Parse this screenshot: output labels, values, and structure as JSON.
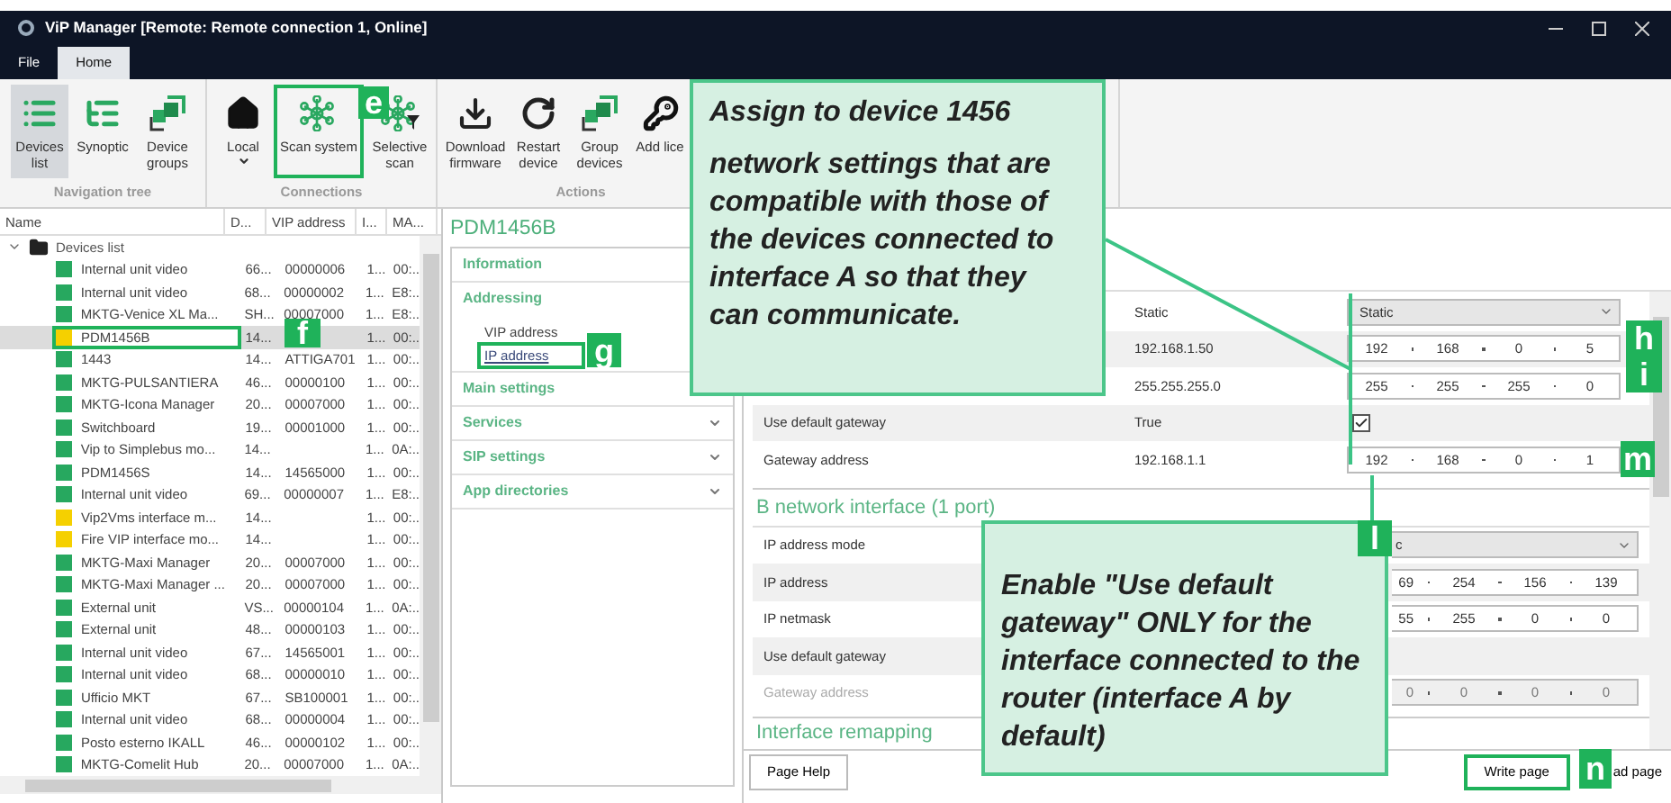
{
  "window": {
    "title": "ViP Manager [Remote: Remote connection 1, Online]"
  },
  "menu": [
    {
      "label": "File",
      "selected": false
    },
    {
      "label": "Home",
      "selected": true
    }
  ],
  "ribbon": [
    {
      "label": "Navigation tree",
      "buttons": [
        {
          "lines": [
            "Devices",
            "list"
          ],
          "selected": true,
          "dropdown": false,
          "marked": false
        },
        {
          "lines": [
            "Synoptic"
          ],
          "selected": false,
          "dropdown": false,
          "marked": false
        },
        {
          "lines": [
            "Device",
            "groups"
          ],
          "selected": false,
          "dropdown": false,
          "marked": false
        }
      ]
    },
    {
      "label": "Connections",
      "buttons": [
        {
          "lines": [
            "Local"
          ],
          "selected": false,
          "dropdown": true,
          "marked": false
        },
        {
          "lines": [
            "Scan system"
          ],
          "selected": false,
          "dropdown": false,
          "marked": true
        },
        {
          "lines": [
            "Selective",
            "scan"
          ],
          "selected": false,
          "dropdown": false,
          "marked": false
        }
      ]
    },
    {
      "label": "Actions",
      "buttons": [
        {
          "lines": [
            "Download",
            "firmware"
          ],
          "selected": false,
          "dropdown": false,
          "marked": false
        },
        {
          "lines": [
            "Restart",
            "device"
          ],
          "selected": false,
          "dropdown": false,
          "marked": false
        },
        {
          "lines": [
            "Group",
            "devices"
          ],
          "selected": false,
          "dropdown": false,
          "marked": false
        },
        {
          "lines": [
            "Add lice"
          ],
          "selected": false,
          "dropdown": false,
          "marked": false
        }
      ]
    }
  ],
  "tree": {
    "columns": [
      "Name",
      "D...",
      "VIP address",
      "I...",
      "MA..."
    ],
    "root": {
      "label": "Devices list",
      "expanded": true,
      "children": [
        {
          "name": "Internal unit video",
          "color": "#27a85f",
          "d": "66...",
          "vip": "00000006",
          "i": "1...",
          "mac": "00:..",
          "selected": false,
          "marked": false
        },
        {
          "name": "Internal unit video",
          "color": "#27a85f",
          "d": "68...",
          "vip": "00000002",
          "i": "1...",
          "mac": "E8:..",
          "selected": false,
          "marked": false
        },
        {
          "name": "MKTG-Venice XL Ma...",
          "color": "#27a85f",
          "d": "SH...",
          "vip": "00007000",
          "i": "1...",
          "mac": "E8:..",
          "selected": false,
          "marked": false
        },
        {
          "name": "PDM1456B",
          "color": "#f5d000",
          "d": "14...",
          "i": "1...",
          "mac": "00:..",
          "selected": true,
          "marked": true
        },
        {
          "name": "1443",
          "color": "#27a85f",
          "d": "14...",
          "vip": "ATTIGA701",
          "i": "1...",
          "mac": "00:..",
          "selected": false,
          "marked": false
        },
        {
          "name": "MKTG-PULSANTIERA",
          "color": "#27a85f",
          "d": "46...",
          "vip": "00000100",
          "i": "1...",
          "mac": "00:..",
          "selected": false,
          "marked": false
        },
        {
          "name": "MKTG-Icona Manager",
          "color": "#27a85f",
          "d": "20...",
          "vip": "00007000",
          "i": "1...",
          "mac": "00:..",
          "selected": false,
          "marked": false
        },
        {
          "name": "Switchboard",
          "color": "#27a85f",
          "d": "19...",
          "vip": "00001000",
          "i": "1...",
          "mac": "00:..",
          "selected": false,
          "marked": false
        },
        {
          "name": "Vip to Simplebus mo...",
          "color": "#27a85f",
          "d": "14...",
          "i": "1...",
          "mac": "0A:..",
          "selected": false,
          "marked": false
        },
        {
          "name": "PDM1456S",
          "color": "#27a85f",
          "d": "14...",
          "vip": "14565000",
          "i": "1...",
          "mac": "00:..",
          "selected": false,
          "marked": false
        },
        {
          "name": "Internal unit video",
          "color": "#27a85f",
          "d": "69...",
          "vip": "00000007",
          "i": "1...",
          "mac": "E8:..",
          "selected": false,
          "marked": false
        },
        {
          "name": "Vip2Vms interface m...",
          "color": "#f5d000",
          "d": "14...",
          "i": "1...",
          "mac": "00:..",
          "selected": false,
          "marked": false
        },
        {
          "name": "Fire VIP interface mo...",
          "color": "#f5d000",
          "d": "14...",
          "i": "1...",
          "mac": "00:..",
          "selected": false,
          "marked": false
        },
        {
          "name": "MKTG-Maxi Manager",
          "color": "#27a85f",
          "d": "20...",
          "vip": "00007000",
          "i": "1...",
          "mac": "00:..",
          "selected": false,
          "marked": false
        },
        {
          "name": "MKTG-Maxi Manager ...",
          "color": "#27a85f",
          "d": "20...",
          "vip": "00007000",
          "i": "1...",
          "mac": "00:..",
          "selected": false,
          "marked": false
        },
        {
          "name": "External unit",
          "color": "#27a85f",
          "d": "VS...",
          "vip": "00000104",
          "i": "1...",
          "mac": "0A:..",
          "selected": false,
          "marked": false
        },
        {
          "name": "External unit",
          "color": "#27a85f",
          "d": "48...",
          "vip": "00000103",
          "i": "1...",
          "mac": "00:..",
          "selected": false,
          "marked": false
        },
        {
          "name": "Internal unit video",
          "color": "#27a85f",
          "d": "67...",
          "vip": "14565001",
          "i": "1...",
          "mac": "00:..",
          "selected": false,
          "marked": false
        },
        {
          "name": "Internal unit video",
          "color": "#27a85f",
          "d": "68...",
          "vip": "00000010",
          "i": "1...",
          "mac": "00:..",
          "selected": false,
          "marked": false
        },
        {
          "name": "Ufficio MKT",
          "color": "#27a85f",
          "d": "67...",
          "vip": "SB100001",
          "i": "1...",
          "mac": "00:..",
          "selected": false,
          "marked": false
        },
        {
          "name": "Internal unit video",
          "color": "#27a85f",
          "d": "68...",
          "vip": "00000004",
          "i": "1...",
          "mac": "00:..",
          "selected": false,
          "marked": false
        },
        {
          "name": "Posto esterno IKALL",
          "color": "#27a85f",
          "d": "46...",
          "vip": "00000102",
          "i": "1...",
          "mac": "00:..",
          "selected": false,
          "marked": false
        },
        {
          "name": "MKTG-Comelit Hub",
          "color": "#27a85f",
          "d": "20...",
          "vip": "00007000",
          "i": "1...",
          "mac": "0A:..",
          "selected": false,
          "marked": false
        }
      ]
    }
  },
  "nav": {
    "title": "PDM1456B",
    "sections": [
      {
        "label": "Information",
        "chevron": false
      },
      {
        "label": "Addressing",
        "chevron": false,
        "children": [
          {
            "label": "VIP address",
            "selected": false,
            "marked": false
          },
          {
            "label": "IP address",
            "selected": true,
            "marked": true
          }
        ]
      },
      {
        "label": "Main settings",
        "chevron": false
      },
      {
        "label": "Services",
        "chevron": true
      },
      {
        "label": "SIP settings",
        "chevron": true
      },
      {
        "label": "App directories",
        "chevron": true
      }
    ]
  },
  "settings": {
    "a_rows": [
      {
        "value": "Static",
        "editor": {
          "kind": "dropdown",
          "value": "Static"
        }
      },
      {
        "value": "192.168.1.50",
        "editor": {
          "kind": "ip",
          "octets": [
            "192",
            "168",
            "0",
            "5"
          ]
        }
      },
      {
        "value": "255.255.255.0",
        "editor": {
          "kind": "ip",
          "octets": [
            "255",
            "255",
            "255",
            "0"
          ]
        }
      },
      {
        "label": "Use default gateway",
        "value": "True",
        "editor": {
          "kind": "checkbox",
          "checked": true
        }
      },
      {
        "label": "Gateway address",
        "value": "192.168.1.1",
        "editor": {
          "kind": "ip",
          "octets": [
            "192",
            "168",
            "0",
            "1"
          ]
        }
      }
    ],
    "b_title": "B network interface (1 port)",
    "b_rows": [
      {
        "label": "IP address mode",
        "disabled": false,
        "editor": {
          "kind": "dropdown",
          "value": "c"
        }
      },
      {
        "label": "IP address",
        "disabled": false,
        "editor": {
          "kind": "ip",
          "octets": [
            "69",
            "254",
            "156",
            "139"
          ]
        }
      },
      {
        "label": "IP netmask",
        "disabled": false,
        "editor": {
          "kind": "ip",
          "octets": [
            "55",
            "255",
            "0",
            "0"
          ]
        }
      },
      {
        "label": "Use default gateway",
        "disabled": false
      },
      {
        "label": "Gateway address",
        "disabled": true,
        "editor": {
          "kind": "ip",
          "octets": [
            "0",
            "0",
            "0",
            "0"
          ]
        }
      }
    ],
    "next_title": "Interface remapping"
  },
  "footer": [
    {
      "label": "Page Help",
      "marked": false
    },
    {
      "label": "Write page",
      "marked": true
    },
    {
      "label": "ad page",
      "marked": false
    }
  ],
  "annotations": {
    "callouts": [
      {
        "paragraphs": [
          "Assign to device 1456",
          "network settings that are compatible with those of the devices connected to interface A so that they can communicate."
        ]
      },
      {
        "paragraphs": [
          "Enable \"Use default gateway\" ONLY for the interface connected to the router (interface A by default)"
        ]
      }
    ],
    "labels": [
      "e",
      "f",
      "g",
      "h",
      "i",
      "m",
      "l",
      "n"
    ]
  }
}
